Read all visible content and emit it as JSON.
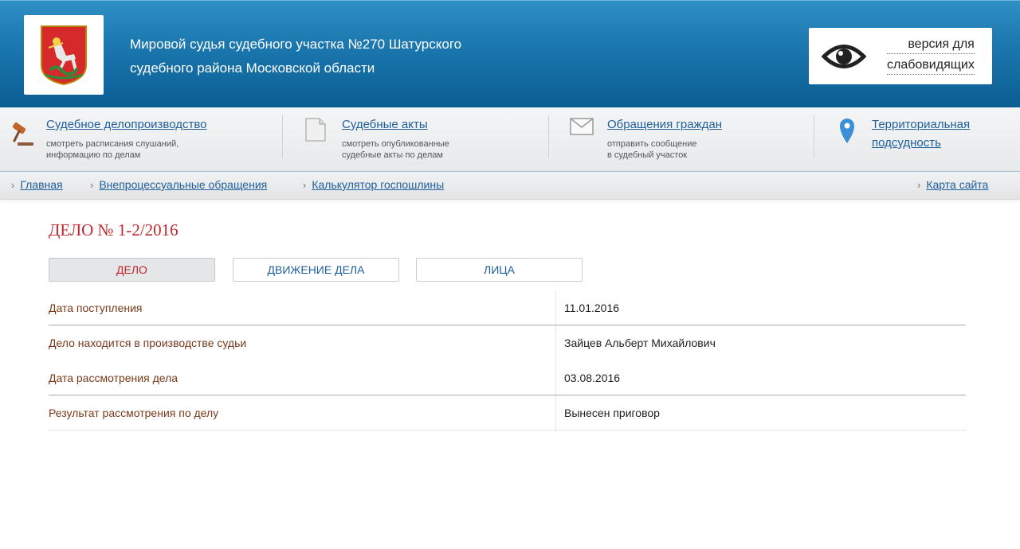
{
  "header": {
    "court_line1": "Мировой судья судебного участка №270 Шатурского",
    "court_line2": "судебного района Московской области",
    "vision_line1": "версия для",
    "vision_line2": "слабовидящих"
  },
  "menu": [
    {
      "title": "Судебное делопроизводство",
      "desc1": "смотреть расписания слушаний,",
      "desc2": "информацию по делам",
      "icon": "gavel-icon"
    },
    {
      "title": "Судебные акты",
      "desc1": "смотреть опубликованные",
      "desc2": "судебные акты по делам",
      "icon": "document-icon"
    },
    {
      "title": "Обращения граждан",
      "desc1": "отправить сообщение",
      "desc2": "в судебный участок",
      "icon": "envelope-icon"
    },
    {
      "title1": "Территориальная",
      "title2": "подсудность",
      "icon": "map-pin-icon"
    }
  ],
  "breadcrumbs": {
    "items": [
      "Главная",
      "Внепроцессуальные обращения",
      "Калькулятор госпошлины"
    ],
    "sitemap": "Карта сайта"
  },
  "case": {
    "title": "ДЕЛО № 1-2/2016",
    "tabs": [
      "ДЕЛО",
      "ДВИЖЕНИЕ ДЕЛА",
      "ЛИЦА"
    ],
    "rows": [
      {
        "label": "Дата поступления",
        "value": "11.01.2016"
      },
      {
        "label": "Дело находится в производстве судьи",
        "value": "Зайцев Альберт Михайлович"
      },
      {
        "label": "Дата рассмотрения дела",
        "value": "03.08.2016"
      },
      {
        "label": "Результат рассмотрения по делу",
        "value": "Вынесен приговор"
      }
    ]
  },
  "colors": {
    "header_blue": "#1a76ad",
    "link_blue": "#1f5f9b",
    "case_red": "#c0282e"
  }
}
